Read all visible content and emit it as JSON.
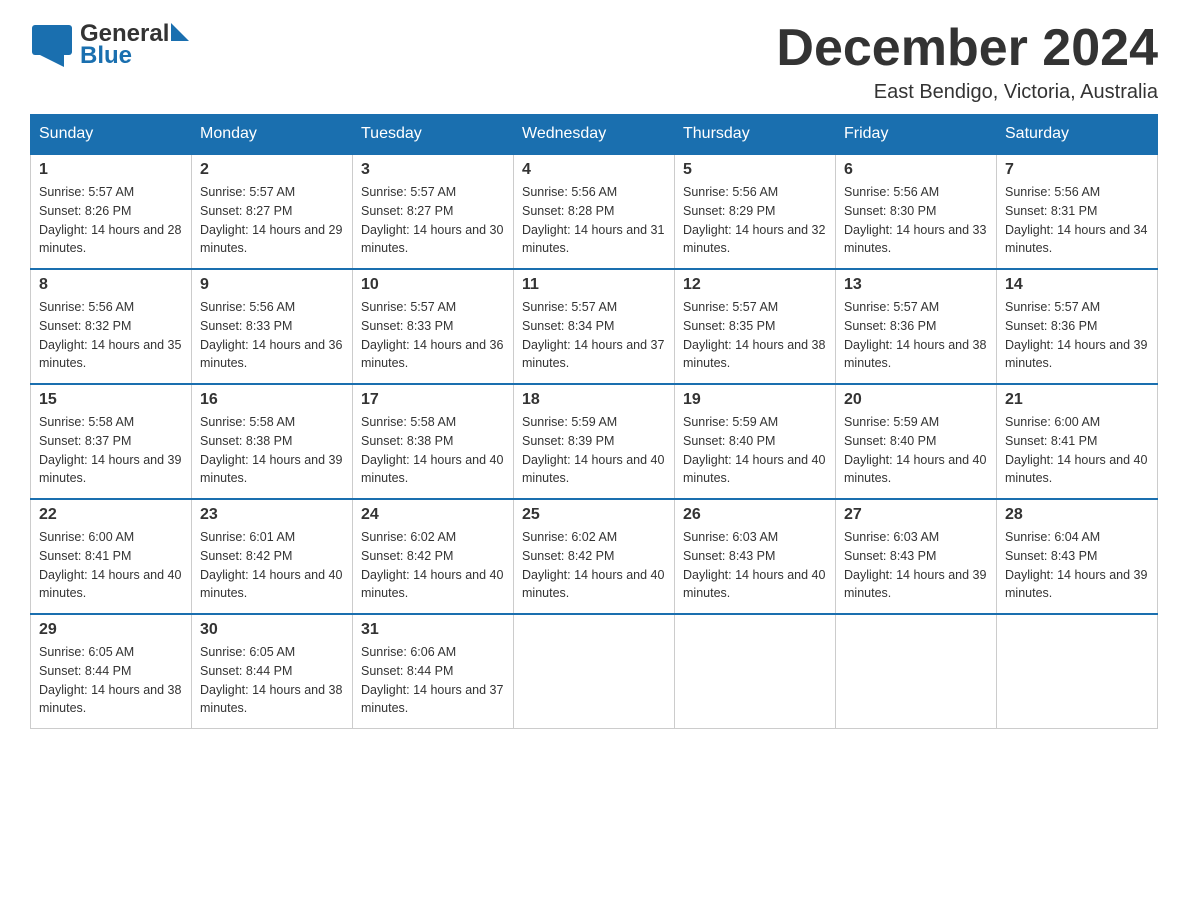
{
  "logo": {
    "general": "General",
    "blue": "Blue"
  },
  "title": "December 2024",
  "location": "East Bendigo, Victoria, Australia",
  "weekdays": [
    "Sunday",
    "Monday",
    "Tuesday",
    "Wednesday",
    "Thursday",
    "Friday",
    "Saturday"
  ],
  "weeks": [
    [
      {
        "day": "1",
        "sunrise": "5:57 AM",
        "sunset": "8:26 PM",
        "daylight": "14 hours and 28 minutes."
      },
      {
        "day": "2",
        "sunrise": "5:57 AM",
        "sunset": "8:27 PM",
        "daylight": "14 hours and 29 minutes."
      },
      {
        "day": "3",
        "sunrise": "5:57 AM",
        "sunset": "8:27 PM",
        "daylight": "14 hours and 30 minutes."
      },
      {
        "day": "4",
        "sunrise": "5:56 AM",
        "sunset": "8:28 PM",
        "daylight": "14 hours and 31 minutes."
      },
      {
        "day": "5",
        "sunrise": "5:56 AM",
        "sunset": "8:29 PM",
        "daylight": "14 hours and 32 minutes."
      },
      {
        "day": "6",
        "sunrise": "5:56 AM",
        "sunset": "8:30 PM",
        "daylight": "14 hours and 33 minutes."
      },
      {
        "day": "7",
        "sunrise": "5:56 AM",
        "sunset": "8:31 PM",
        "daylight": "14 hours and 34 minutes."
      }
    ],
    [
      {
        "day": "8",
        "sunrise": "5:56 AM",
        "sunset": "8:32 PM",
        "daylight": "14 hours and 35 minutes."
      },
      {
        "day": "9",
        "sunrise": "5:56 AM",
        "sunset": "8:33 PM",
        "daylight": "14 hours and 36 minutes."
      },
      {
        "day": "10",
        "sunrise": "5:57 AM",
        "sunset": "8:33 PM",
        "daylight": "14 hours and 36 minutes."
      },
      {
        "day": "11",
        "sunrise": "5:57 AM",
        "sunset": "8:34 PM",
        "daylight": "14 hours and 37 minutes."
      },
      {
        "day": "12",
        "sunrise": "5:57 AM",
        "sunset": "8:35 PM",
        "daylight": "14 hours and 38 minutes."
      },
      {
        "day": "13",
        "sunrise": "5:57 AM",
        "sunset": "8:36 PM",
        "daylight": "14 hours and 38 minutes."
      },
      {
        "day": "14",
        "sunrise": "5:57 AM",
        "sunset": "8:36 PM",
        "daylight": "14 hours and 39 minutes."
      }
    ],
    [
      {
        "day": "15",
        "sunrise": "5:58 AM",
        "sunset": "8:37 PM",
        "daylight": "14 hours and 39 minutes."
      },
      {
        "day": "16",
        "sunrise": "5:58 AM",
        "sunset": "8:38 PM",
        "daylight": "14 hours and 39 minutes."
      },
      {
        "day": "17",
        "sunrise": "5:58 AM",
        "sunset": "8:38 PM",
        "daylight": "14 hours and 40 minutes."
      },
      {
        "day": "18",
        "sunrise": "5:59 AM",
        "sunset": "8:39 PM",
        "daylight": "14 hours and 40 minutes."
      },
      {
        "day": "19",
        "sunrise": "5:59 AM",
        "sunset": "8:40 PM",
        "daylight": "14 hours and 40 minutes."
      },
      {
        "day": "20",
        "sunrise": "5:59 AM",
        "sunset": "8:40 PM",
        "daylight": "14 hours and 40 minutes."
      },
      {
        "day": "21",
        "sunrise": "6:00 AM",
        "sunset": "8:41 PM",
        "daylight": "14 hours and 40 minutes."
      }
    ],
    [
      {
        "day": "22",
        "sunrise": "6:00 AM",
        "sunset": "8:41 PM",
        "daylight": "14 hours and 40 minutes."
      },
      {
        "day": "23",
        "sunrise": "6:01 AM",
        "sunset": "8:42 PM",
        "daylight": "14 hours and 40 minutes."
      },
      {
        "day": "24",
        "sunrise": "6:02 AM",
        "sunset": "8:42 PM",
        "daylight": "14 hours and 40 minutes."
      },
      {
        "day": "25",
        "sunrise": "6:02 AM",
        "sunset": "8:42 PM",
        "daylight": "14 hours and 40 minutes."
      },
      {
        "day": "26",
        "sunrise": "6:03 AM",
        "sunset": "8:43 PM",
        "daylight": "14 hours and 40 minutes."
      },
      {
        "day": "27",
        "sunrise": "6:03 AM",
        "sunset": "8:43 PM",
        "daylight": "14 hours and 39 minutes."
      },
      {
        "day": "28",
        "sunrise": "6:04 AM",
        "sunset": "8:43 PM",
        "daylight": "14 hours and 39 minutes."
      }
    ],
    [
      {
        "day": "29",
        "sunrise": "6:05 AM",
        "sunset": "8:44 PM",
        "daylight": "14 hours and 38 minutes."
      },
      {
        "day": "30",
        "sunrise": "6:05 AM",
        "sunset": "8:44 PM",
        "daylight": "14 hours and 38 minutes."
      },
      {
        "day": "31",
        "sunrise": "6:06 AM",
        "sunset": "8:44 PM",
        "daylight": "14 hours and 37 minutes."
      },
      null,
      null,
      null,
      null
    ]
  ]
}
